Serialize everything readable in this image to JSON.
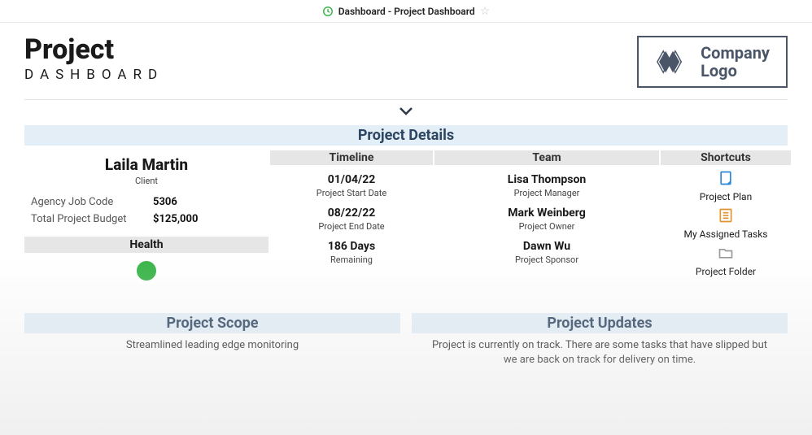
{
  "topbar": {
    "title": "Dashboard - Project Dashboard"
  },
  "header": {
    "title": "Project",
    "subtitle": "DASHBOARD",
    "logo_line1": "Company",
    "logo_line2": "Logo"
  },
  "project_details": {
    "band": "Project Details",
    "client": {
      "name": "Laila Martin",
      "role": "Client",
      "agency_code_label": "Agency Job Code",
      "agency_code": "5306",
      "budget_label": "Total Project Budget",
      "budget": "$125,000",
      "health_label": "Health",
      "health_color": "#3ab54a"
    },
    "timeline": {
      "heading": "Timeline",
      "start_date": "01/04/22",
      "start_label": "Project Start Date",
      "end_date": "08/22/22",
      "end_label": "Project End Date",
      "remaining": "186 Days",
      "remaining_label": "Remaining"
    },
    "team": {
      "heading": "Team",
      "members": [
        {
          "name": "Lisa Thompson",
          "role": "Project Manager"
        },
        {
          "name": "Mark Weinberg",
          "role": "Project Owner"
        },
        {
          "name": "Dawn Wu",
          "role": "Project Sponsor"
        }
      ]
    },
    "shortcuts": {
      "heading": "Shortcuts",
      "items": [
        {
          "label": "Project Plan"
        },
        {
          "label": "My Assigned Tasks"
        },
        {
          "label": "Project Folder"
        }
      ]
    }
  },
  "scope": {
    "heading": "Project Scope",
    "text": "Streamlined leading edge monitoring"
  },
  "updates": {
    "heading": "Project Updates",
    "text": "Project is currently on track. There are some tasks that have slipped but we are back on track for delivery on time."
  }
}
